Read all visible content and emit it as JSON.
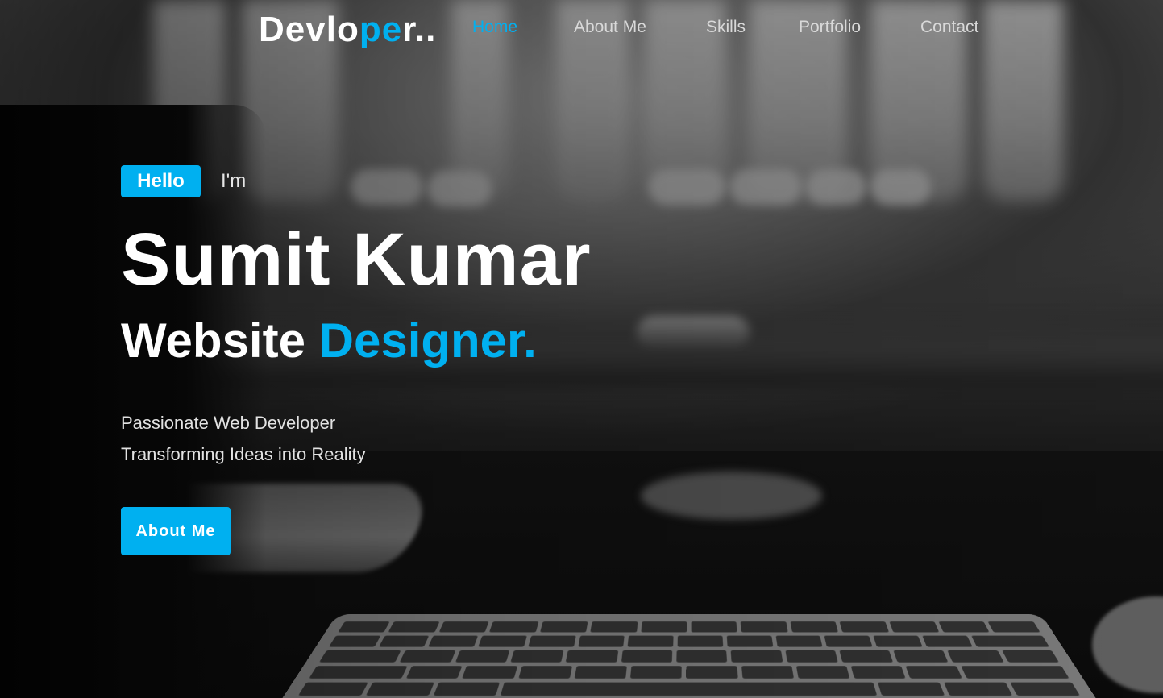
{
  "header": {
    "logo": {
      "part1": "Devlo",
      "part2": "pe",
      "part3": "r.."
    },
    "nav": [
      {
        "label": "Home",
        "active": true
      },
      {
        "label": "About Me",
        "active": false
      },
      {
        "label": "Skills",
        "active": false
      },
      {
        "label": "Portfolio",
        "active": false
      },
      {
        "label": "Contact",
        "active": false
      }
    ]
  },
  "hero": {
    "greeting_badge": "Hello",
    "greeting_suffix": "I'm",
    "name": "Sumit Kumar",
    "role_prefix": "Website",
    "role_highlight": "Designer.",
    "tagline_lines": [
      "Passionate Web Developer",
      "Transforming Ideas into Reality"
    ],
    "cta_label": "About Me"
  },
  "theme": {
    "accent": "#00b0f0",
    "text": "#ffffff",
    "background": "#0a0a0a"
  },
  "background_image": "blurred monochrome desk with keyboard and laptop"
}
